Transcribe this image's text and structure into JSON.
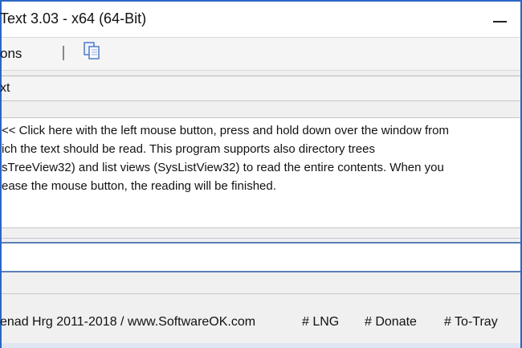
{
  "window": {
    "title": "Text 3.03 - x64 (64-Bit)"
  },
  "toolbar": {
    "menu_label": "ons",
    "copy_icon": "copy-icon"
  },
  "panel": {
    "label": "xt"
  },
  "main_text": {
    "lines": [
      "<< Click here with the left mouse button, press and hold down over the window from",
      "ich the text should be read. This program supports also directory trees",
      "sTreeView32) and list views (SysListView32) to read the entire contents. When you",
      "ease the mouse button, the reading will be finished."
    ]
  },
  "status_bar": {
    "copyright": "enad Hrg 2011-2018 / www.SoftwareOK.com",
    "lng": "# LNG",
    "donate": "# Donate",
    "tray": "# To-Tray"
  }
}
